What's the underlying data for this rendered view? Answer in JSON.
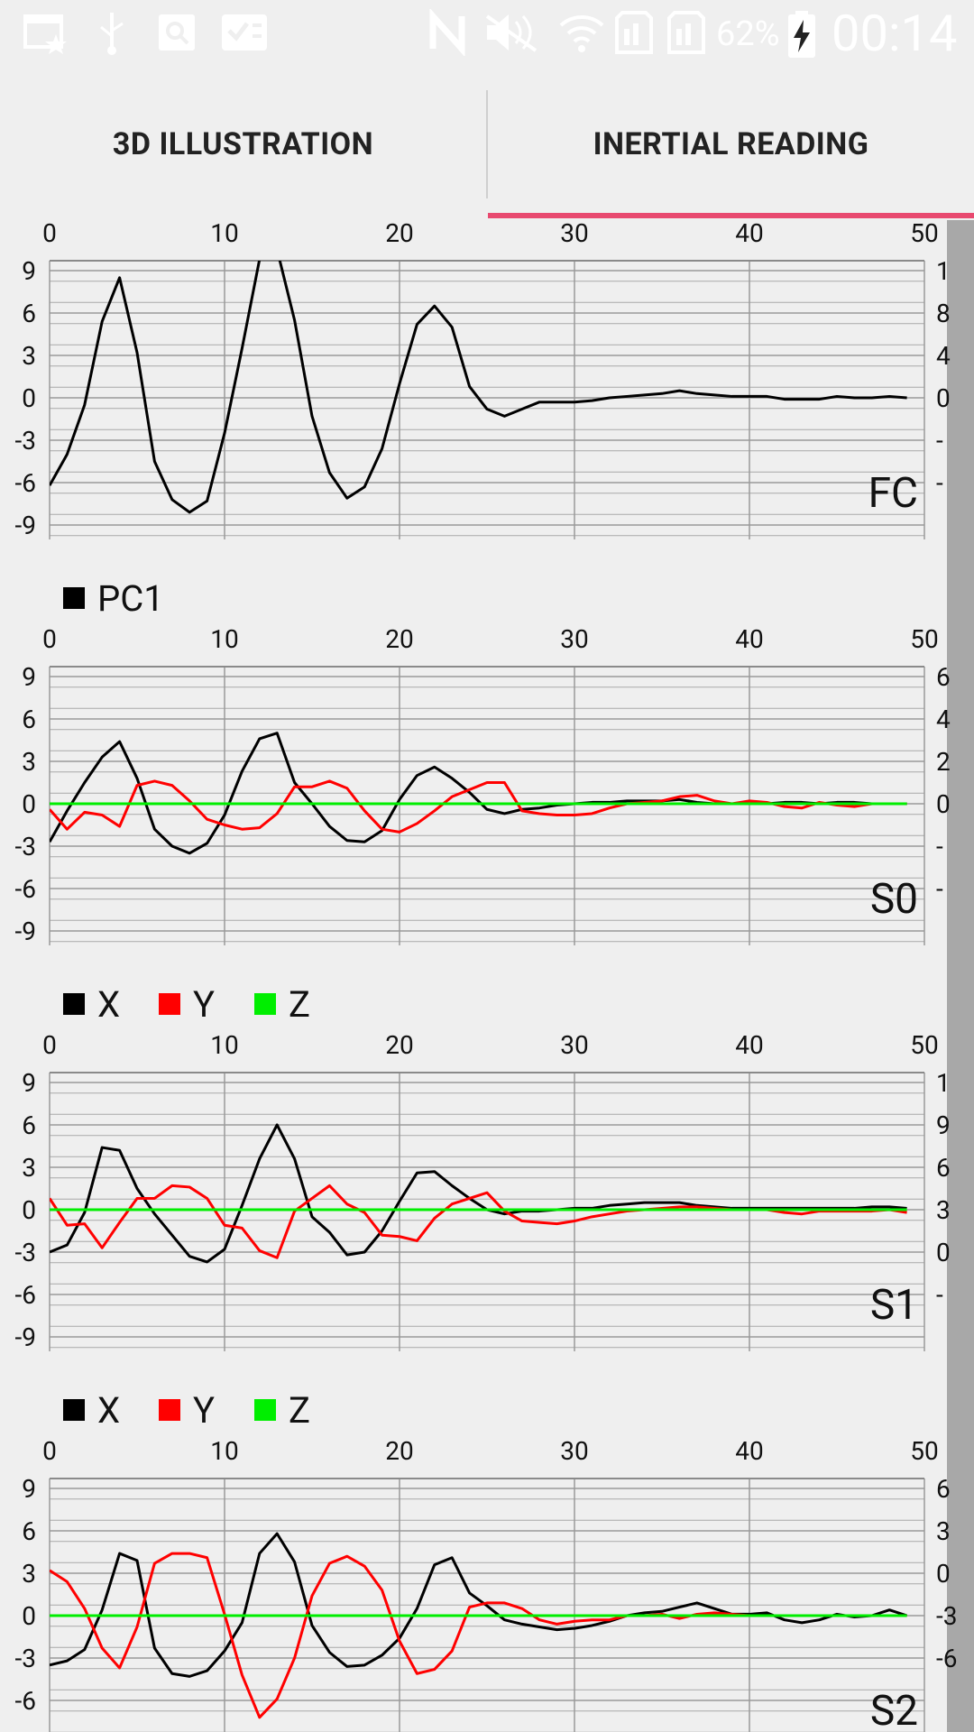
{
  "status_bar": {
    "battery": "62%",
    "time": "00:14",
    "left_icons": [
      "calendar-star-icon",
      "usb-icon",
      "image-search-icon",
      "checklist-icon"
    ],
    "right_icons": [
      "nfc-icon",
      "mute-icon",
      "wifi-icon",
      "sim1-icon",
      "sim2-icon",
      "battery-charging-icon"
    ]
  },
  "tabs": [
    {
      "label": "3D ILLUSTRATION",
      "active": false
    },
    {
      "label": "INERTIAL READING",
      "active": true
    }
  ],
  "colors": {
    "accent": "#e8496f",
    "x": "#000000",
    "y": "#ff0000",
    "z": "#00ee00",
    "pc1": "#000000"
  },
  "chart_data": [
    {
      "type": "line",
      "title": "FC",
      "x_ticks": [
        0,
        10,
        20,
        30,
        40,
        50
      ],
      "y_ticks": [
        9,
        6,
        3,
        0,
        -3,
        -6,
        -9
      ],
      "right_ticks": [
        "1",
        "8",
        "4",
        "0",
        "-",
        "-"
      ],
      "ylim": [
        -10,
        10
      ],
      "xlim": [
        0,
        50
      ],
      "grid": true,
      "series": [
        {
          "color": "#000000",
          "values": [
            -6.2,
            -4.0,
            -0.5,
            5.4,
            8.5,
            3.2,
            -4.5,
            -7.2,
            -8.1,
            -7.3,
            -2.5,
            3.5,
            9.8,
            10.5,
            5.5,
            -1.3,
            -5.3,
            -7.1,
            -6.3,
            -3.6,
            1.0,
            5.2,
            6.5,
            5.0,
            0.8,
            -0.8,
            -1.3,
            -0.8,
            -0.3,
            -0.3,
            -0.3,
            -0.2,
            0.0,
            0.1,
            0.2,
            0.3,
            0.5,
            0.3,
            0.2,
            0.1,
            0.1,
            0.1,
            -0.1,
            -0.1,
            -0.1,
            0.1,
            0.0,
            0.0,
            0.1,
            0.0
          ]
        }
      ]
    },
    {
      "type": "line",
      "title": "S0",
      "legend": [
        {
          "name": "PC1",
          "color": "#000000"
        }
      ],
      "x_ticks": [
        0,
        10,
        20,
        30,
        40,
        50
      ],
      "y_ticks": [
        9,
        6,
        3,
        0,
        -3,
        -6,
        -9
      ],
      "right_ticks": [
        "6",
        "4",
        "2",
        "0",
        "-",
        "-"
      ],
      "ylim": [
        -10,
        10
      ],
      "xlim": [
        0,
        50
      ],
      "grid": true,
      "series": [
        {
          "color": "#000000",
          "values": [
            -2.7,
            -0.5,
            1.5,
            3.3,
            4.4,
            1.8,
            -1.8,
            -3.0,
            -3.5,
            -2.8,
            -0.8,
            2.3,
            4.6,
            5.0,
            1.5,
            0.0,
            -1.6,
            -2.6,
            -2.7,
            -1.9,
            0.3,
            2.0,
            2.6,
            1.8,
            0.8,
            -0.4,
            -0.7,
            -0.4,
            -0.3,
            -0.1,
            0.0,
            0.1,
            0.1,
            0.2,
            0.2,
            0.2,
            0.3,
            0.1,
            0.0,
            0.0,
            0.0,
            0.0,
            0.1,
            0.1,
            0.0,
            0.1,
            0.1,
            0.0,
            0.0,
            0.0
          ]
        },
        {
          "color": "#ff0000",
          "values": [
            -0.4,
            -1.8,
            -0.6,
            -0.8,
            -1.6,
            1.3,
            1.6,
            1.3,
            0.2,
            -1.1,
            -1.5,
            -1.8,
            -1.7,
            -0.7,
            1.2,
            1.2,
            1.6,
            1.1,
            -0.5,
            -1.8,
            -2.0,
            -1.4,
            -0.5,
            0.5,
            1.0,
            1.5,
            1.5,
            -0.5,
            -0.7,
            -0.8,
            -0.8,
            -0.7,
            -0.3,
            0.0,
            0.1,
            0.2,
            0.5,
            0.6,
            0.2,
            0.0,
            0.2,
            0.1,
            -0.2,
            -0.3,
            0.1,
            -0.1,
            -0.2,
            0.0,
            0.0,
            0.0
          ]
        },
        {
          "color": "#00ee00",
          "values": [
            0.0,
            0.0,
            0.0,
            0.0,
            0.0,
            0.0,
            0.0,
            0.0,
            0.0,
            0.0,
            0.0,
            0.0,
            0.0,
            0.0,
            0.0,
            0.0,
            0.0,
            0.0,
            0.0,
            0.0,
            0.0,
            0.0,
            0.0,
            0.0,
            0.0,
            0.0,
            0.0,
            0.0,
            0.0,
            0.0,
            0.0,
            0.0,
            0.0,
            0.0,
            0.0,
            0.0,
            0.0,
            0.0,
            0.0,
            0.0,
            0.0,
            0.0,
            0.0,
            0.0,
            0.0,
            0.0,
            0.0,
            0.0,
            0.0,
            0.0
          ]
        }
      ]
    },
    {
      "type": "line",
      "title": "S1",
      "legend": [
        {
          "name": "X",
          "color": "#000000"
        },
        {
          "name": "Y",
          "color": "#ff0000"
        },
        {
          "name": "Z",
          "color": "#00ee00"
        }
      ],
      "x_ticks": [
        0,
        10,
        20,
        30,
        40,
        50
      ],
      "y_ticks": [
        9,
        6,
        3,
        0,
        -3,
        -6,
        -9
      ],
      "right_ticks": [
        "1",
        "9",
        "6",
        "3",
        "0",
        "-"
      ],
      "ylim": [
        -10,
        10
      ],
      "xlim": [
        0,
        50
      ],
      "grid": true,
      "series": [
        {
          "color": "#000000",
          "values": [
            -3.0,
            -2.5,
            -0.2,
            4.4,
            4.2,
            1.5,
            -0.3,
            -1.8,
            -3.3,
            -3.7,
            -2.8,
            0.3,
            3.6,
            6.0,
            3.6,
            -0.5,
            -1.6,
            -3.2,
            -3.0,
            -1.5,
            0.6,
            2.6,
            2.7,
            1.7,
            0.8,
            0.0,
            -0.3,
            -0.1,
            -0.1,
            0.0,
            0.1,
            0.1,
            0.3,
            0.4,
            0.5,
            0.5,
            0.5,
            0.3,
            0.2,
            0.1,
            0.1,
            0.1,
            0.1,
            0.1,
            0.1,
            0.1,
            0.1,
            0.2,
            0.2,
            0.1
          ]
        },
        {
          "color": "#ff0000",
          "values": [
            0.8,
            -1.1,
            -1.0,
            -2.7,
            -0.9,
            0.8,
            0.8,
            1.7,
            1.6,
            0.8,
            -1.1,
            -1.3,
            -2.9,
            -3.4,
            -0.1,
            0.8,
            1.7,
            0.4,
            -0.2,
            -1.8,
            -1.9,
            -2.2,
            -0.6,
            0.4,
            0.8,
            1.2,
            -0.1,
            -0.8,
            -0.9,
            -1.0,
            -0.8,
            -0.5,
            -0.3,
            -0.1,
            0.0,
            0.1,
            0.2,
            0.2,
            0.1,
            0.0,
            0.0,
            0.0,
            -0.2,
            -0.3,
            -0.1,
            -0.1,
            -0.1,
            -0.1,
            0.0,
            -0.2
          ]
        },
        {
          "color": "#00ee00",
          "values": [
            0.0,
            0.0,
            0.0,
            0.0,
            0.0,
            0.0,
            0.0,
            0.0,
            0.0,
            0.0,
            0.0,
            0.0,
            0.0,
            0.0,
            0.0,
            0.0,
            0.0,
            0.0,
            0.0,
            0.0,
            0.0,
            0.0,
            0.0,
            0.0,
            0.0,
            0.0,
            0.0,
            0.0,
            0.0,
            0.0,
            0.0,
            0.0,
            0.0,
            0.0,
            0.0,
            0.0,
            0.0,
            0.0,
            0.0,
            0.0,
            0.0,
            0.0,
            0.0,
            0.0,
            0.0,
            0.0,
            0.0,
            0.0,
            0.0,
            0.0
          ]
        }
      ]
    },
    {
      "type": "line",
      "title": "S2",
      "legend": [
        {
          "name": "X",
          "color": "#000000"
        },
        {
          "name": "Y",
          "color": "#ff0000"
        },
        {
          "name": "Z",
          "color": "#00ee00"
        }
      ],
      "x_ticks": [
        0,
        10,
        20,
        30,
        40,
        50
      ],
      "y_ticks": [
        9,
        6,
        3,
        0,
        -3,
        -6
      ],
      "right_ticks": [
        "6",
        "3",
        "0",
        "-3",
        "-6"
      ],
      "ylim": [
        -10,
        10
      ],
      "xlim": [
        0,
        50
      ],
      "grid": true,
      "series": [
        {
          "color": "#000000",
          "values": [
            -3.5,
            -3.2,
            -2.4,
            0.4,
            4.4,
            3.9,
            -2.3,
            -4.1,
            -4.3,
            -3.9,
            -2.5,
            -0.5,
            4.4,
            5.8,
            3.8,
            -0.7,
            -2.6,
            -3.6,
            -3.5,
            -2.8,
            -1.6,
            0.5,
            3.6,
            4.1,
            1.6,
            0.7,
            -0.3,
            -0.6,
            -0.8,
            -1.0,
            -0.9,
            -0.7,
            -0.4,
            0.0,
            0.2,
            0.3,
            0.6,
            0.9,
            0.5,
            0.1,
            0.1,
            0.2,
            -0.3,
            -0.5,
            -0.3,
            0.1,
            -0.1,
            0.0,
            0.4,
            0.0
          ]
        },
        {
          "color": "#ff0000",
          "values": [
            3.2,
            2.4,
            0.5,
            -2.3,
            -3.7,
            -0.8,
            3.7,
            4.4,
            4.4,
            4.1,
            0.1,
            -4.2,
            -7.2,
            -5.9,
            -3.0,
            1.4,
            3.7,
            4.2,
            3.5,
            1.8,
            -1.8,
            -4.1,
            -3.8,
            -2.5,
            0.6,
            0.9,
            0.9,
            0.5,
            -0.3,
            -0.6,
            -0.4,
            -0.3,
            -0.3,
            0.0,
            0.0,
            0.1,
            -0.2,
            0.1,
            0.2,
            0.1,
            0.0,
            0.0,
            0.0,
            0.0,
            0.0,
            0.0,
            0.0,
            0.0,
            0.0,
            0.0
          ]
        },
        {
          "color": "#00ee00",
          "values": [
            0.0,
            0.0,
            0.0,
            0.0,
            0.0,
            0.0,
            0.0,
            0.0,
            0.0,
            0.0,
            0.0,
            0.0,
            0.0,
            0.0,
            0.0,
            0.0,
            0.0,
            0.0,
            0.0,
            0.0,
            0.0,
            0.0,
            0.0,
            0.0,
            0.0,
            0.0,
            0.0,
            0.0,
            0.0,
            0.0,
            0.0,
            0.0,
            0.0,
            0.0,
            0.0,
            0.0,
            0.0,
            0.0,
            0.0,
            0.0,
            0.0,
            0.0,
            0.0,
            0.0,
            0.0,
            0.0,
            0.0,
            0.0,
            0.0,
            0.0
          ]
        }
      ]
    }
  ]
}
